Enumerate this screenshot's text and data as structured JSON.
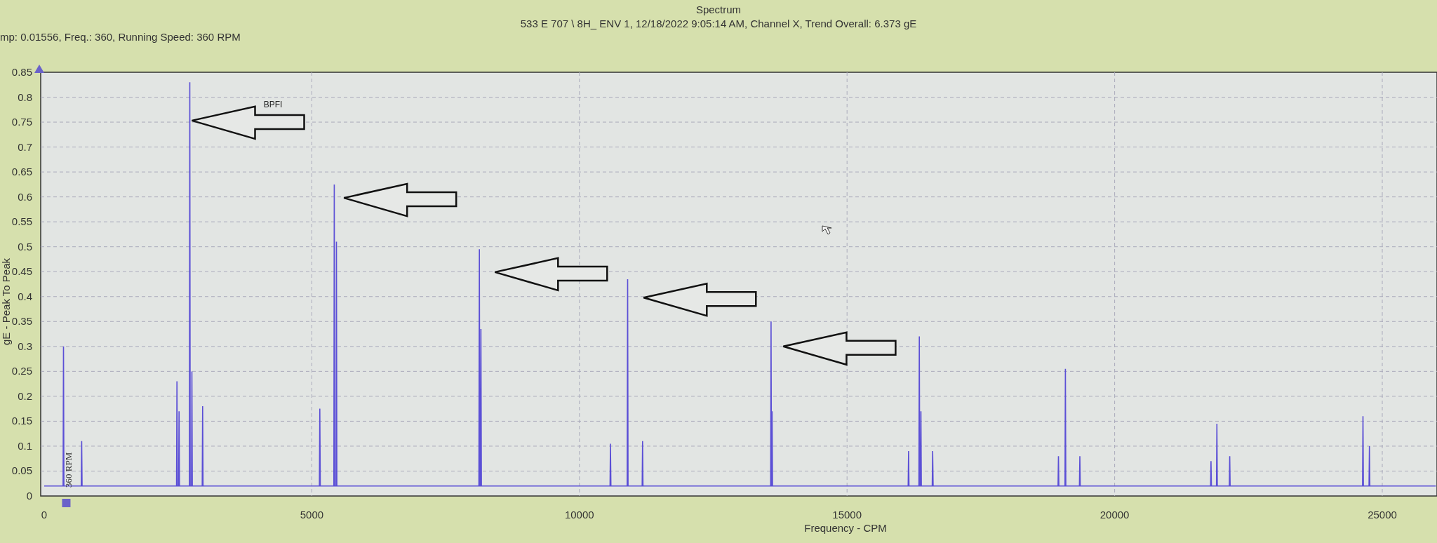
{
  "header": {
    "title": "Spectrum",
    "subtitle": "533 E 707 \\ 8H_ ENV 1, 12/18/2022 9:05:14 AM, Channel X, Trend Overall: 6.373 gE",
    "cursor_info": "mp: 0.01556, Freq.: 360, Running Speed: 360 RPM"
  },
  "spectrum": {
    "running_speed_label": "360 RPM",
    "chart_data": {
      "type": "line",
      "xlabel": "Frequency - CPM",
      "ylabel": "gE - Peak To Peak",
      "grid": true,
      "xlim": [
        0,
        26000
      ],
      "ylim": [
        0,
        0.85
      ],
      "xticks": [
        0,
        5000,
        10000,
        15000,
        20000,
        25000
      ],
      "yticks": [
        0,
        0.05,
        {
          "value": 0.1,
          "label": "0.1"
        },
        0.15,
        {
          "value": 0.2,
          "label": "0.2"
        },
        0.25,
        {
          "value": 0.3,
          "label": "0.3"
        },
        0.35,
        {
          "value": 0.4,
          "label": "0.4"
        },
        0.45,
        {
          "value": 0.5,
          "label": "0.5"
        },
        0.55,
        {
          "value": 0.6,
          "label": "0.6"
        },
        0.65,
        {
          "value": 0.7,
          "label": "0.7"
        },
        0.75,
        {
          "value": 0.8,
          "label": "0.8"
        },
        0.85
      ],
      "x": [
        0,
        352,
        360,
        368,
        692,
        700,
        708,
        2472,
        2480,
        2488,
        2512,
        2520,
        2528,
        2712,
        2720,
        2728,
        2752,
        2760,
        2768,
        2952,
        2960,
        2968,
        5142,
        5150,
        5158,
        5412,
        5420,
        5428,
        5452,
        5460,
        5468,
        8122,
        8130,
        8138,
        8152,
        8160,
        8168,
        10572,
        10580,
        10588,
        10892,
        10900,
        10908,
        11172,
        11180,
        11188,
        13572,
        13580,
        13588,
        13592,
        13600,
        13608,
        16142,
        16150,
        16158,
        16342,
        16350,
        16358,
        16372,
        16380,
        16388,
        16592,
        16600,
        16608,
        18942,
        18950,
        18958,
        19072,
        19080,
        19088,
        19342,
        19350,
        19358,
        21792,
        21800,
        21808,
        21902,
        21910,
        21918,
        22142,
        22150,
        22158,
        24632,
        24640,
        24648,
        24752,
        24760,
        24768,
        26000
      ],
      "series": [
        {
          "color": "#5b4fd6",
          "values": [
            0.02,
            0.02,
            0.3,
            0.02,
            0.02,
            0.11,
            0.02,
            0.02,
            0.23,
            0.02,
            0.02,
            0.17,
            0.02,
            0.02,
            0.83,
            0.02,
            0.02,
            0.25,
            0.02,
            0.02,
            0.18,
            0.02,
            0.02,
            0.175,
            0.02,
            0.02,
            0.625,
            0.02,
            0.02,
            0.51,
            0.02,
            0.02,
            0.495,
            0.02,
            0.02,
            0.335,
            0.02,
            0.02,
            0.105,
            0.02,
            0.02,
            0.435,
            0.02,
            0.02,
            0.11,
            0.02,
            0.02,
            0.35,
            0.02,
            0.02,
            0.17,
            0.02,
            0.02,
            0.09,
            0.02,
            0.02,
            0.32,
            0.02,
            0.02,
            0.17,
            0.02,
            0.02,
            0.09,
            0.02,
            0.02,
            0.08,
            0.02,
            0.02,
            0.255,
            0.02,
            0.02,
            0.08,
            0.02,
            0.02,
            0.07,
            0.02,
            0.02,
            0.145,
            0.02,
            0.02,
            0.08,
            0.02,
            0.02,
            0.16,
            0.02,
            0.02,
            0.1,
            0.02,
            0.02
          ]
        }
      ],
      "annotations": [
        "BPFI"
      ]
    }
  }
}
